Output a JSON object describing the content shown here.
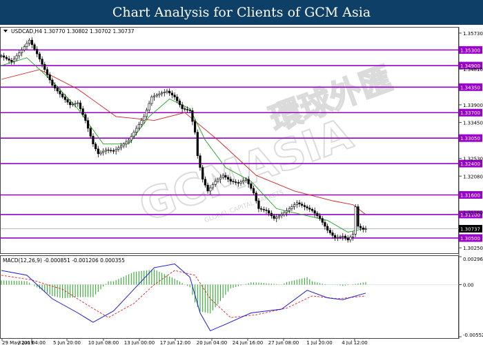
{
  "banner": {
    "title": "Chart Analysis for Clients of GCM Asia"
  },
  "chart_data": {
    "type": "candlestick",
    "symbol_header": "USDCAD,H4  1.30770 1.30802 1.30702 1.30737",
    "price_axis": {
      "min": 1.3013,
      "max": 1.3587,
      "tick_labels": [
        "1.35730",
        "1.34810",
        "1.33900",
        "1.33450",
        "1.32530",
        "1.32080",
        "1.31160",
        "1.30250"
      ]
    },
    "support_resistance_levels": [
      {
        "value": 1.353,
        "label": "1.35300"
      },
      {
        "value": 1.349,
        "label": "1.34900"
      },
      {
        "value": 1.3435,
        "label": "1.34350"
      },
      {
        "value": 1.337,
        "label": "1.33700"
      },
      {
        "value": 1.3305,
        "label": "1.33050"
      },
      {
        "value": 1.324,
        "label": "1.32400"
      },
      {
        "value": 1.316,
        "label": "1.31600"
      },
      {
        "value": 1.311,
        "label": "1.31100"
      },
      {
        "value": 1.305,
        "label": "1.30500"
      }
    ],
    "current_price": {
      "value": 1.30737,
      "label": "1.30737"
    },
    "x_tick_labels": [
      "29 May 2019",
      "3 Jun 04:00",
      "5 Jun 20:00",
      "10 Jun 08:00",
      "13 Jun 00:00",
      "17 Jun 12:00",
      "20 Jun 04:00",
      "24 Jun 16:00",
      "27 Jun 08:00",
      "1 Jul 20:00",
      "4 Jul 12:00"
    ],
    "close_path": [
      [
        0,
        1.3515
      ],
      [
        4,
        1.35
      ],
      [
        8,
        1.353
      ],
      [
        11,
        1.3555
      ],
      [
        14,
        1.352
      ],
      [
        17,
        1.348
      ],
      [
        20,
        1.344
      ],
      [
        24,
        1.341
      ],
      [
        27,
        1.339
      ],
      [
        30,
        1.3395
      ],
      [
        33,
        1.335
      ],
      [
        36,
        1.329
      ],
      [
        38,
        1.3265
      ],
      [
        41,
        1.3275
      ],
      [
        44,
        1.3272
      ],
      [
        47,
        1.3285
      ],
      [
        50,
        1.33
      ],
      [
        53,
        1.333
      ],
      [
        56,
        1.336
      ],
      [
        59,
        1.341
      ],
      [
        62,
        1.3418
      ],
      [
        65,
        1.3425
      ],
      [
        68,
        1.341
      ],
      [
        71,
        1.338
      ],
      [
        74,
        1.3375
      ],
      [
        76,
        1.332
      ],
      [
        77,
        1.326
      ],
      [
        79,
        1.32
      ],
      [
        81,
        1.317
      ],
      [
        84,
        1.3195
      ],
      [
        87,
        1.321
      ],
      [
        90,
        1.3195
      ],
      [
        93,
        1.319
      ],
      [
        96,
        1.32
      ],
      [
        99,
        1.3165
      ],
      [
        101,
        1.3125
      ],
      [
        104,
        1.312
      ],
      [
        107,
        1.31
      ],
      [
        110,
        1.311
      ],
      [
        113,
        1.3125
      ],
      [
        116,
        1.314
      ],
      [
        119,
        1.313
      ],
      [
        122,
        1.312
      ],
      [
        125,
        1.31
      ],
      [
        128,
        1.307
      ],
      [
        131,
        1.305
      ],
      [
        134,
        1.3055
      ],
      [
        136,
        1.3045
      ],
      [
        138,
        1.306
      ],
      [
        139,
        1.313
      ],
      [
        140,
        1.308
      ],
      [
        142,
        1.3072
      ],
      [
        143,
        1.30737
      ]
    ],
    "ma_fast_path": [
      [
        0,
        1.349
      ],
      [
        10,
        1.351
      ],
      [
        20,
        1.345
      ],
      [
        30,
        1.338
      ],
      [
        40,
        1.329
      ],
      [
        50,
        1.329
      ],
      [
        58,
        1.336
      ],
      [
        66,
        1.3405
      ],
      [
        74,
        1.338
      ],
      [
        80,
        1.33
      ],
      [
        88,
        1.323
      ],
      [
        98,
        1.3195
      ],
      [
        108,
        1.3125
      ],
      [
        118,
        1.311
      ],
      [
        128,
        1.3095
      ],
      [
        136,
        1.3065
      ],
      [
        143,
        1.3075
      ]
    ],
    "ma_slow_path": [
      [
        0,
        1.3455
      ],
      [
        15,
        1.348
      ],
      [
        30,
        1.343
      ],
      [
        45,
        1.336
      ],
      [
        60,
        1.335
      ],
      [
        72,
        1.337
      ],
      [
        85,
        1.33
      ],
      [
        100,
        1.321
      ],
      [
        115,
        1.317
      ],
      [
        130,
        1.3145
      ],
      [
        138,
        1.3135
      ],
      [
        143,
        1.311
      ]
    ],
    "ma_colors": {
      "fast": "#19a319",
      "slow": "#d42020"
    },
    "level_color": "#9900cc",
    "macd": {
      "header": "MACD(12,26,9) -0.000851 -0.001206 0.000355",
      "min": -0.005529,
      "max": 0.002967,
      "tick_labels": [
        "0.002967",
        "0.00",
        "-0.005529"
      ],
      "macd_path": [
        [
          0,
          0.0015
        ],
        [
          10,
          0.001
        ],
        [
          20,
          -0.0015
        ],
        [
          30,
          -0.003
        ],
        [
          36,
          -0.004
        ],
        [
          44,
          -0.0028
        ],
        [
          52,
          -0.0005
        ],
        [
          60,
          0.0018
        ],
        [
          68,
          0.0022
        ],
        [
          74,
          0.0008
        ],
        [
          78,
          -0.003
        ],
        [
          82,
          -0.0049
        ],
        [
          88,
          -0.0042
        ],
        [
          98,
          -0.003
        ],
        [
          110,
          -0.0026
        ],
        [
          120,
          -0.0006
        ],
        [
          128,
          -0.0014
        ],
        [
          134,
          -0.0016
        ],
        [
          143,
          -0.0009
        ]
      ],
      "signal_path": [
        [
          0,
          0.001
        ],
        [
          12,
          0.0005
        ],
        [
          24,
          -0.0005
        ],
        [
          34,
          -0.0022
        ],
        [
          42,
          -0.0035
        ],
        [
          52,
          -0.002
        ],
        [
          60,
          0.0
        ],
        [
          68,
          0.0015
        ],
        [
          76,
          0.001
        ],
        [
          82,
          -0.0015
        ],
        [
          90,
          -0.0035
        ],
        [
          100,
          -0.0032
        ],
        [
          112,
          -0.0025
        ],
        [
          122,
          -0.0012
        ],
        [
          132,
          -0.0015
        ],
        [
          143,
          -0.0012
        ]
      ],
      "colors": {
        "macd": "#1a1ad6",
        "signal": "#e02020",
        "histogram": "#2ea82e"
      }
    },
    "watermark": {
      "main": "GCMASIA",
      "sub": "GLOBAL CAPITAL MARKETS",
      "cn": "環球外匯"
    }
  }
}
